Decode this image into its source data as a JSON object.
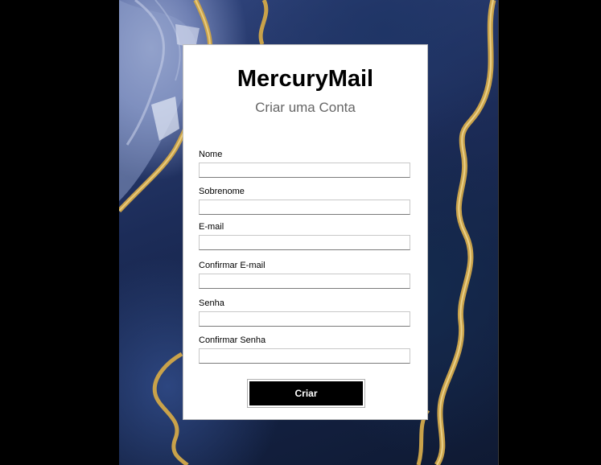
{
  "app": {
    "title": "MercuryMail",
    "subtitle": "Criar uma Conta"
  },
  "form": {
    "fields": [
      {
        "label": "Nome",
        "value": ""
      },
      {
        "label": "Sobrenome",
        "value": ""
      },
      {
        "label": "E-mail",
        "value": ""
      },
      {
        "label": "Confirmar E-mail",
        "value": ""
      },
      {
        "label": "Senha",
        "value": ""
      },
      {
        "label": "Confirmar Senha",
        "value": ""
      }
    ],
    "submit_label": "Criar"
  },
  "colors": {
    "card_background": "#ffffff",
    "button_background": "#000000",
    "button_text": "#ffffff",
    "subtitle_text": "#666666",
    "marble_gold": "#c9a24a",
    "marble_navy": "#1c2c58"
  }
}
